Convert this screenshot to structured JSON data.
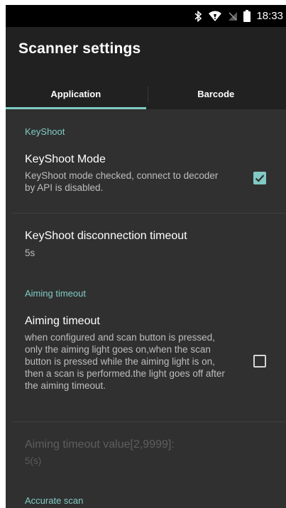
{
  "status_bar": {
    "time": "18:33",
    "icons": [
      "bluetooth-icon",
      "wifi-icon",
      "no-sim-icon",
      "battery-icon"
    ]
  },
  "app_bar": {
    "title": "Scanner settings"
  },
  "tabs": [
    {
      "label": "Application",
      "active": true
    },
    {
      "label": "Barcode",
      "active": false
    }
  ],
  "sections": {
    "keyshoot": {
      "header": "KeyShoot",
      "mode_title": "KeyShoot Mode",
      "mode_summary": "KeyShoot mode checked, connect to decoder by API is disabled.",
      "mode_checked": true,
      "disconnect_title": "KeyShoot disconnection timeout",
      "disconnect_value": "5s"
    },
    "aiming": {
      "header": "Aiming timeout",
      "title": "Aiming timeout",
      "summary": "when configured and scan button is pressed, only the aiming light goes on,when the scan button is pressed while the aiming light is on, then a scan is performed.the light goes off after the aiming timeout.",
      "checked": false,
      "value_title": "Aiming timeout value[2,9999]:",
      "value_summary": "5(s)"
    },
    "accurate": {
      "header": "Accurate scan"
    }
  },
  "colors": {
    "accent": "#80cbc4",
    "background": "#303030",
    "app_bar": "#212121"
  }
}
